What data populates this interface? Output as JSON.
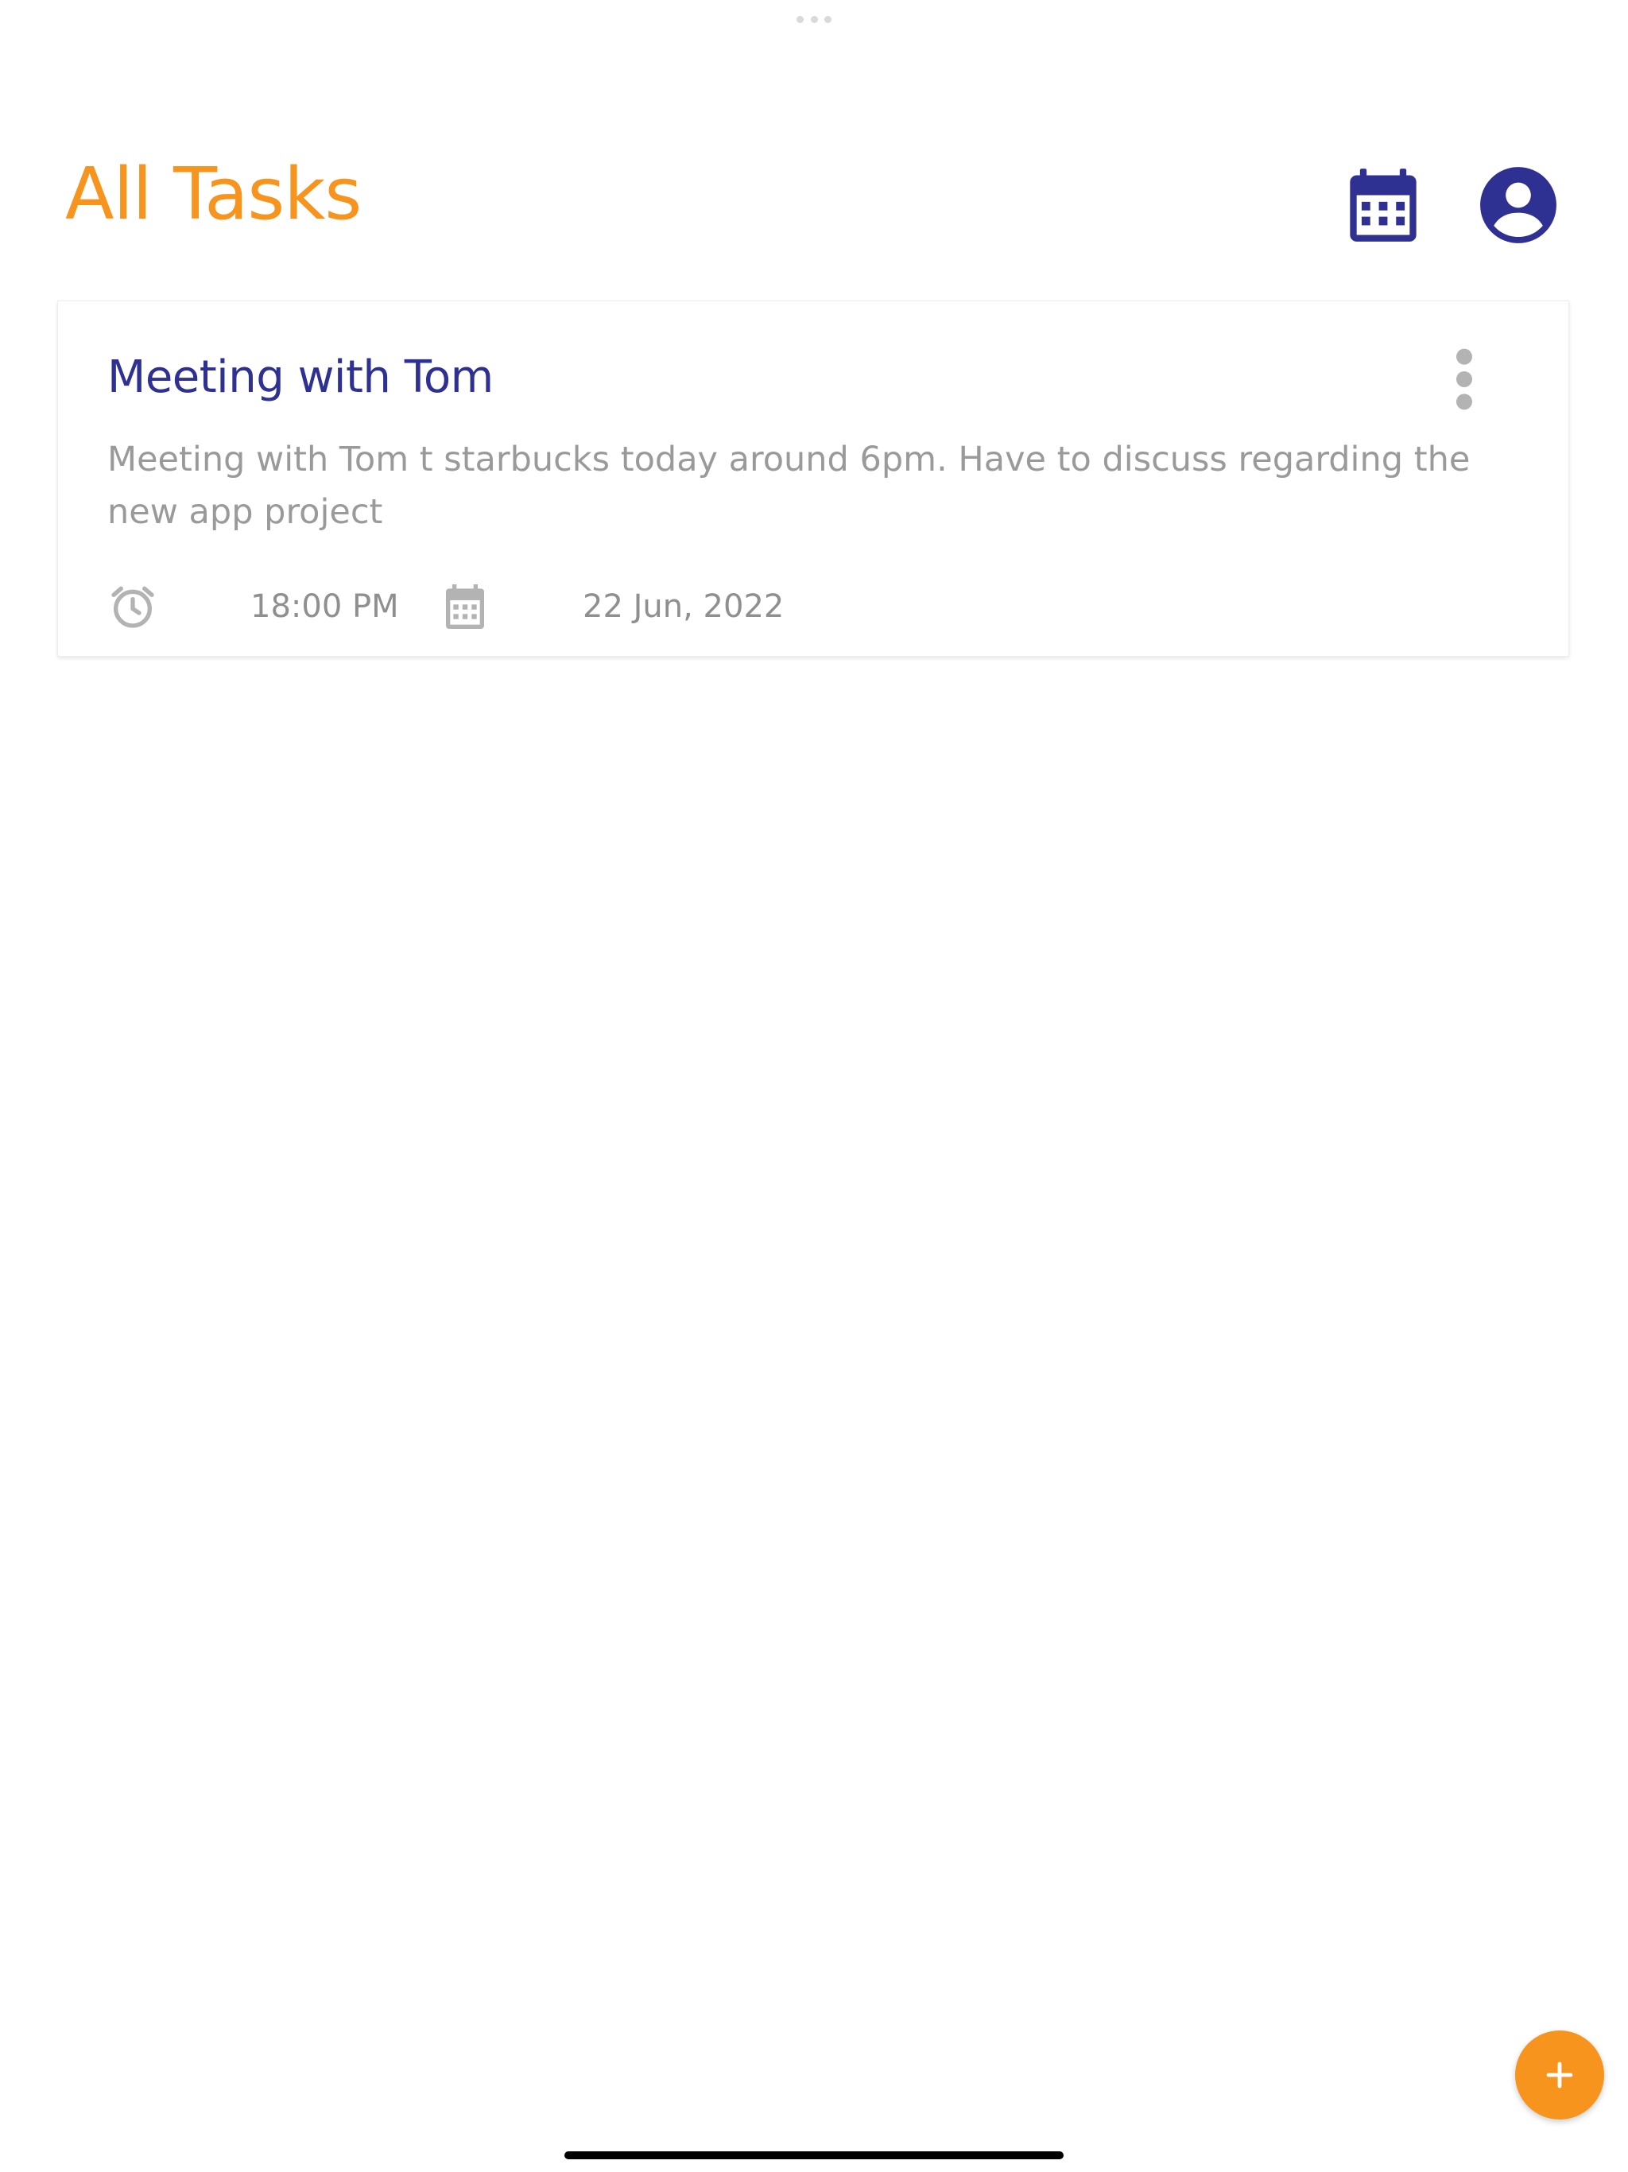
{
  "header": {
    "title": "All Tasks",
    "calendar_icon": "calendar-icon",
    "profile_icon": "account-circle-icon"
  },
  "tasks": [
    {
      "title": "Meeting with Tom",
      "description": "Meeting with Tom t starbucks today around 6pm. Have to discuss regarding the new app project",
      "time": "18:00 PM",
      "date": "22 Jun, 2022",
      "time_icon": "alarm-icon",
      "date_icon": "calendar-icon",
      "menu_icon": "more-vertical-icon"
    }
  ],
  "fab": {
    "icon": "plus-icon"
  },
  "colors": {
    "accent": "#f7941d",
    "primary": "#2e3192",
    "muted_text": "#9a9a9a",
    "icon_grey": "#b3b3b3"
  }
}
